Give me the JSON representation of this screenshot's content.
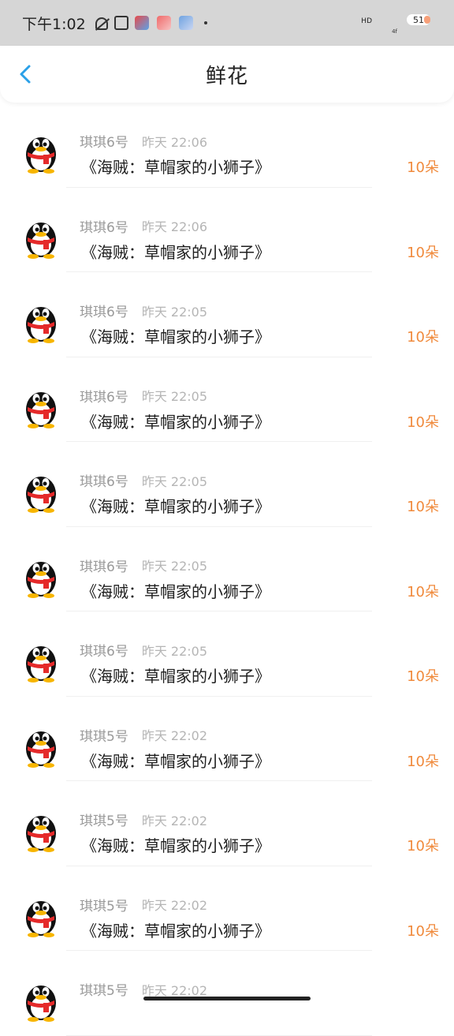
{
  "status_bar": {
    "time": "下午1:02",
    "hd": "HD",
    "signal": "4f",
    "battery": "51",
    "icons": [
      "bell-off-icon",
      "nfc-icon",
      "app-icon",
      "app-icon",
      "app-icon",
      "dot-icon"
    ]
  },
  "nav": {
    "title": "鲜花",
    "back_icon": "chevron-left-icon"
  },
  "colors": {
    "accent": "#2aa0e8",
    "count": "#f08a3c",
    "secondary_text": "#9a9a9a"
  },
  "records": [
    {
      "sender": "琪琪6号",
      "time": "昨天 22:06",
      "gift": "《海贼：草帽家的小狮子》",
      "count": "10朵"
    },
    {
      "sender": "琪琪6号",
      "time": "昨天 22:06",
      "gift": "《海贼：草帽家的小狮子》",
      "count": "10朵"
    },
    {
      "sender": "琪琪6号",
      "time": "昨天 22:05",
      "gift": "《海贼：草帽家的小狮子》",
      "count": "10朵"
    },
    {
      "sender": "琪琪6号",
      "time": "昨天 22:05",
      "gift": "《海贼：草帽家的小狮子》",
      "count": "10朵"
    },
    {
      "sender": "琪琪6号",
      "time": "昨天 22:05",
      "gift": "《海贼：草帽家的小狮子》",
      "count": "10朵"
    },
    {
      "sender": "琪琪6号",
      "time": "昨天 22:05",
      "gift": "《海贼：草帽家的小狮子》",
      "count": "10朵"
    },
    {
      "sender": "琪琪6号",
      "time": "昨天 22:05",
      "gift": "《海贼：草帽家的小狮子》",
      "count": "10朵"
    },
    {
      "sender": "琪琪5号",
      "time": "昨天 22:02",
      "gift": "《海贼：草帽家的小狮子》",
      "count": "10朵"
    },
    {
      "sender": "琪琪5号",
      "time": "昨天 22:02",
      "gift": "《海贼：草帽家的小狮子》",
      "count": "10朵"
    },
    {
      "sender": "琪琪5号",
      "time": "昨天 22:02",
      "gift": "《海贼：草帽家的小狮子》",
      "count": "10朵"
    },
    {
      "sender": "琪琪5号",
      "time": "昨天 22:02",
      "gift": "",
      "count": ""
    }
  ]
}
